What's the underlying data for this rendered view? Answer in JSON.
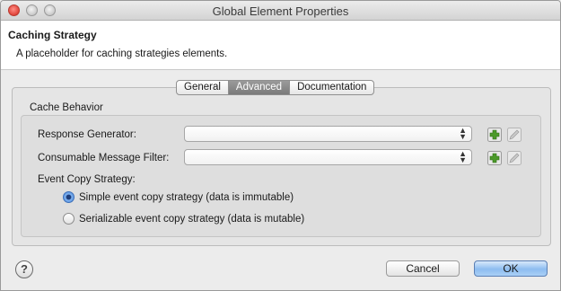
{
  "window": {
    "title": "Global Element Properties"
  },
  "header": {
    "title": "Caching Strategy",
    "description": "A placeholder for caching strategies elements."
  },
  "tabs": [
    {
      "label": "General",
      "active": false
    },
    {
      "label": "Advanced",
      "active": true
    },
    {
      "label": "Documentation",
      "active": false
    }
  ],
  "cache_behavior": {
    "group_label": "Cache Behavior",
    "response_generator": {
      "label": "Response Generator:",
      "value": ""
    },
    "consumable_message_filter": {
      "label": "Consumable Message Filter:",
      "value": ""
    },
    "event_copy_strategy": {
      "label": "Event Copy Strategy:",
      "options": [
        {
          "label": "Simple event copy strategy (data is immutable)",
          "selected": true
        },
        {
          "label": "Serializable event copy strategy (data is mutable)",
          "selected": false
        }
      ]
    }
  },
  "icons": {
    "add": "add-icon",
    "edit": "edit-icon",
    "help": "help-icon"
  },
  "footer": {
    "help_glyph": "?",
    "cancel_label": "Cancel",
    "ok_label": "OK"
  },
  "colors": {
    "active_tab": "#868686",
    "add_icon_green": "#4c9a2a",
    "ok_button_blue": "#8dbdf0",
    "radio_selected": "#4a86d8"
  }
}
